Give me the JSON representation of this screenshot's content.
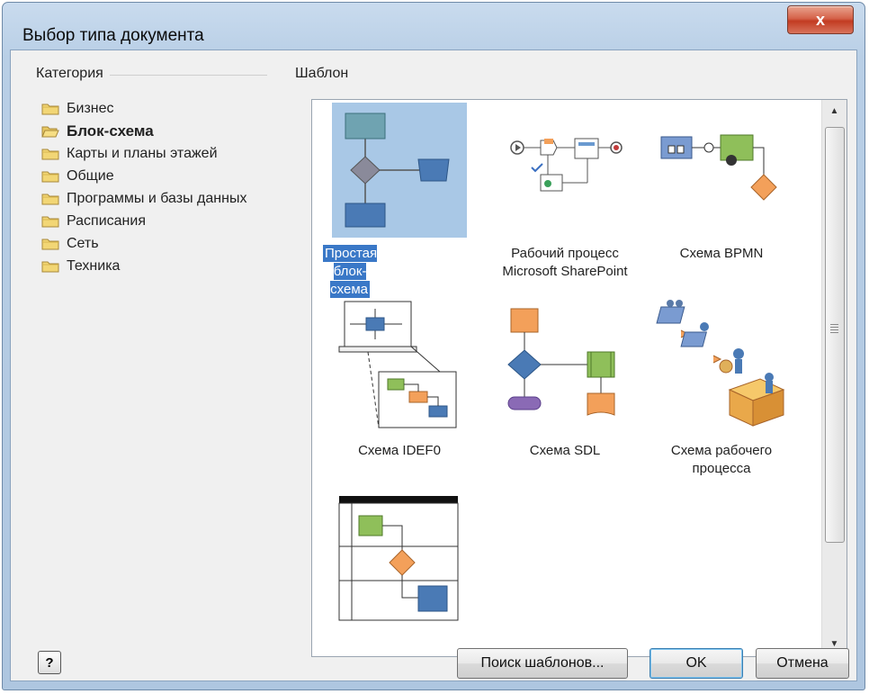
{
  "window": {
    "title": "Выбор типа документа",
    "close_glyph": "x"
  },
  "categories": {
    "label": "Категория",
    "items": [
      {
        "label": "Бизнес",
        "selected": false
      },
      {
        "label": "Блок-схема",
        "selected": true
      },
      {
        "label": "Карты и планы этажей",
        "selected": false
      },
      {
        "label": "Общие",
        "selected": false
      },
      {
        "label": "Программы и базы данных",
        "selected": false
      },
      {
        "label": "Расписания",
        "selected": false
      },
      {
        "label": "Сеть",
        "selected": false
      },
      {
        "label": "Техника",
        "selected": false
      }
    ]
  },
  "templates": {
    "label": "Шаблон",
    "items": [
      {
        "label": "Простая блок-схема",
        "icon": "basic-flowchart-icon",
        "selected": true
      },
      {
        "label": "Рабочий процесс\nMicrosoft SharePoint",
        "icon": "sharepoint-workflow-icon",
        "selected": false
      },
      {
        "label": "Схема BPMN",
        "icon": "bpmn-diagram-icon",
        "selected": false
      },
      {
        "label": "Схема IDEF0",
        "icon": "idef0-diagram-icon",
        "selected": false
      },
      {
        "label": "Схема SDL",
        "icon": "sdl-diagram-icon",
        "selected": false
      },
      {
        "label": "Схема рабочего\nпроцесса",
        "icon": "workflow-diagram-icon",
        "selected": false
      },
      {
        "label": "",
        "icon": "cross-functional-flowchart-icon",
        "selected": false
      }
    ]
  },
  "buttons": {
    "help": "?",
    "find_templates": "Поиск шаблонов...",
    "ok": "OK",
    "cancel": "Отмена"
  },
  "colors": {
    "selection_bg": "#a9c8e6",
    "selection_text_bg": "#3a78c7",
    "shape_blue": "#4a7ab5",
    "shape_teal": "#6fa3b1",
    "shape_green": "#8fbf5a",
    "shape_orange": "#f3a05a",
    "shape_purple": "#8a6ab5"
  }
}
